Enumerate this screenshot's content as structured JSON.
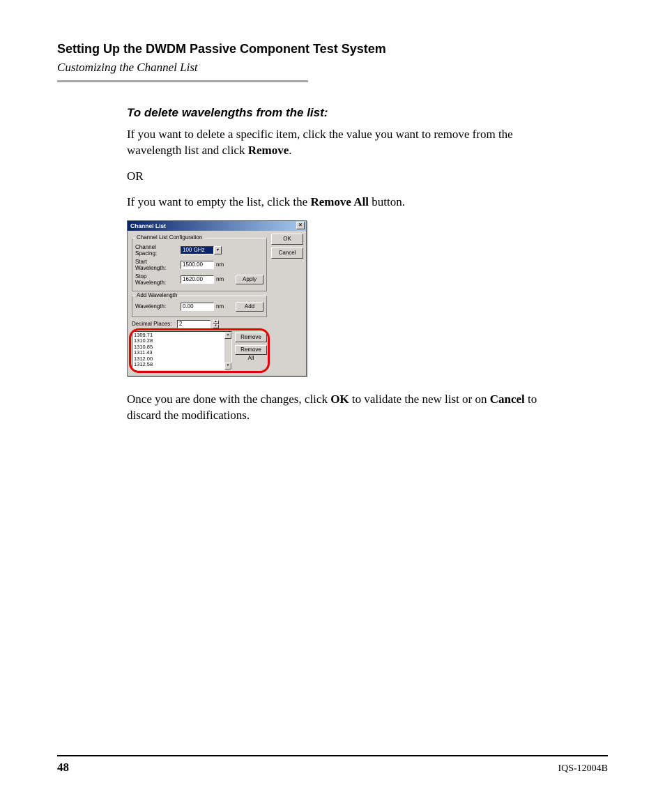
{
  "header": {
    "title": "Setting Up the DWDM Passive Component Test System",
    "subtitle": "Customizing the Channel List"
  },
  "section": {
    "heading": "To delete wavelengths from the list:",
    "p1a": "If you want to delete a specific item, click the value you want to remove from the wavelength list and click ",
    "p1b": "Remove",
    "p1c": ".",
    "or": "OR",
    "p2a": "If you want to empty the list, click the ",
    "p2b": "Remove All",
    "p2c": " button.",
    "p3a": "Once you are done with the changes, click ",
    "p3b": "OK",
    "p3c": " to validate the new list or on ",
    "p3d": "Cancel",
    "p3e": " to discard the modifications."
  },
  "dialog": {
    "title": "Channel List",
    "close": "×",
    "group1": {
      "legend": "Channel List Configuration",
      "spacing_label": "Channel Spacing:",
      "spacing_value": "100 GHz",
      "start_label": "Start Wavelength:",
      "start_value": "1500.00",
      "stop_label": "Stop Wavelength:",
      "stop_value": "1620.00",
      "unit": "nm",
      "apply": "Apply"
    },
    "group2": {
      "legend": "Add Wavelength",
      "wl_label": "Wavelength:",
      "wl_value": "0.00",
      "unit": "nm",
      "add": "Add"
    },
    "decimal": {
      "label": "Decimal Places:",
      "value": "2"
    },
    "list": {
      "items": [
        "1309.71",
        "1310.28",
        "1310.85",
        "1311.43",
        "1312.00",
        "1312.58"
      ],
      "remove": "Remove",
      "remove_all": "Remove All"
    },
    "ok": "OK",
    "cancel": "Cancel"
  },
  "footer": {
    "page": "48",
    "docid": "IQS-12004B"
  }
}
